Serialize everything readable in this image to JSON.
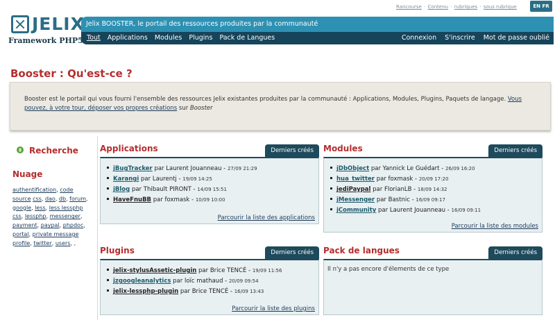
{
  "header": {
    "logo": {
      "word": "JELIX",
      "sub": "Framework PHP5"
    },
    "topnav": [
      "Rancourse",
      "Contenu",
      "rubriques",
      "sous rubrique"
    ],
    "lang": "EN FR",
    "tagline": "Jelix BOOSTER, le portail des ressources produites par la communauté",
    "menu": [
      "Tout",
      "Applications",
      "Modules",
      "Plugins",
      "Pack de Langues"
    ],
    "user_menu": [
      "Connexion",
      "S'inscrire",
      "Mot de passe oublié"
    ]
  },
  "page": {
    "title": "Booster : Qu'est-ce ?",
    "intro_text": "Booster est le portail qui vous fourni l'ensemble des ressources Jelix existantes produites par la communauté : Applications, Modules, Plugins, Paquets de langage. ",
    "intro_link": "Vous pouvez, à votre tour, déposer vos propres créations",
    "intro_tail": " sur ",
    "intro_em": "Booster"
  },
  "sidebar": {
    "search": "Recherche",
    "nuage": "Nuage",
    "tags": [
      "authentification",
      "code source",
      "css",
      "dao",
      "db",
      "forum",
      "google",
      "less",
      "less lessphp css",
      "lessphp",
      "messenger",
      "payment",
      "paypal",
      "phpdoc",
      "portal",
      "private message",
      "profile",
      "twitter",
      "users"
    ]
  },
  "panels": {
    "recent_label": "Derniers créés",
    "by": "par",
    "applications": {
      "title": "Applications",
      "items": [
        {
          "name": "jBugTracker",
          "author": "Laurent Jouanneau",
          "date": "27/09 21:29"
        },
        {
          "name": "Karangi",
          "author": "Laurentj",
          "date": "19/09 14:25"
        },
        {
          "name": "jBlog",
          "author": "Thibault PIRONT",
          "date": "14/09 15:51"
        },
        {
          "name": "HaveFnuBB",
          "author": "foxmask",
          "date": "10/09 10:00"
        }
      ],
      "footer": "Parcourir la liste des applications"
    },
    "modules": {
      "title": "Modules",
      "items": [
        {
          "name": "jDbObject",
          "author": "Yannick Le Guédart",
          "date": "26/09 16:20"
        },
        {
          "name": "hua_twitter",
          "author": "foxmask",
          "date": "20/09 17:20"
        },
        {
          "name": "jediPaypal",
          "author": "FlorianLB",
          "date": "18/09 14:32"
        },
        {
          "name": "jMessenger",
          "author": "Bastnic",
          "date": "16/09 09:17"
        },
        {
          "name": "jCommunity",
          "author": "Laurent Jouanneau",
          "date": "16/09 09:11"
        }
      ],
      "footer": "Parcourir la liste des modules"
    },
    "plugins": {
      "title": "Plugins",
      "items": [
        {
          "name": "jelix-stylusAssetic-plugin",
          "author": "Brice TENCÉ",
          "date": "19/09 11:56"
        },
        {
          "name": "jzgoogleanalytics",
          "author": "loïc mathaud",
          "date": "20/09 09:54"
        },
        {
          "name": "jelix-lessphp-plugin",
          "author": "Brice TENCÉ",
          "date": "16/09 13:43"
        }
      ],
      "footer": "Parcourir la liste des plugins"
    },
    "langs": {
      "title": "Pack de langues",
      "empty": "Il n'y a pas encore d'élements de ce type"
    }
  }
}
